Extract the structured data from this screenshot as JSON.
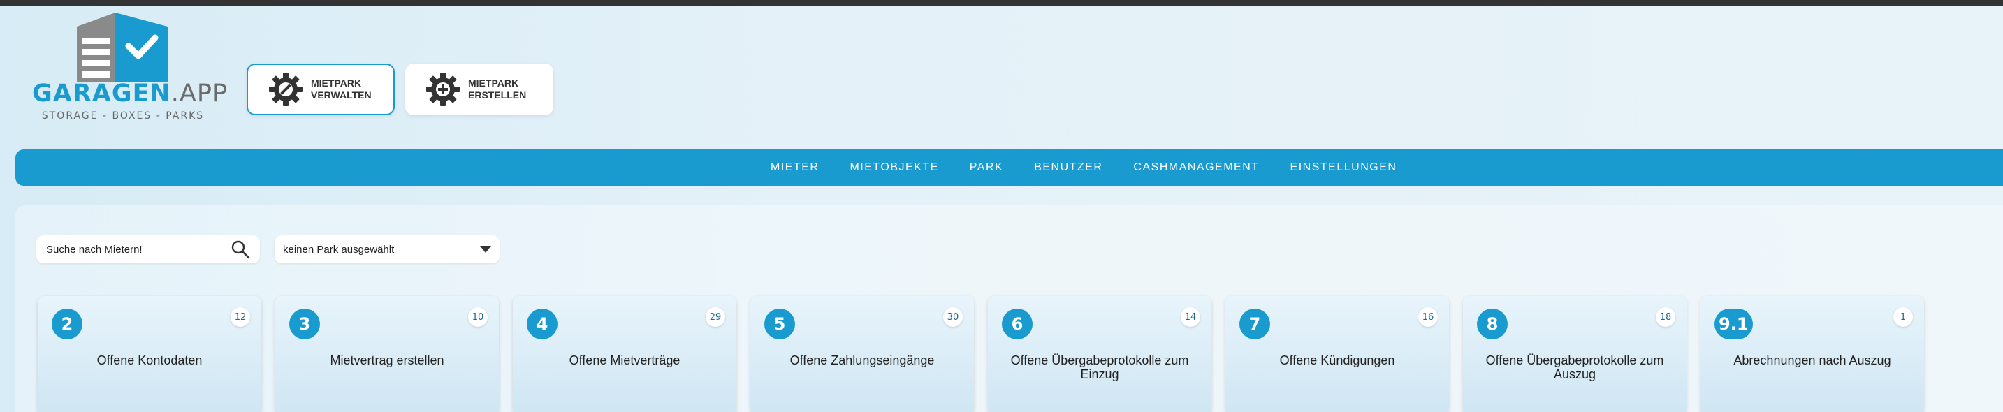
{
  "logo": {
    "word_primary": "GARAGEN",
    "word_secondary": ".APP",
    "tagline": "STORAGE - BOXES - PARKS"
  },
  "top_buttons": [
    {
      "label": "MIETPARK\nVERWALTEN",
      "icon": "gear-wrench-icon",
      "active": true
    },
    {
      "label": "MIETPARK\nERSTELLEN",
      "icon": "gear-plus-icon",
      "active": false
    }
  ],
  "nav": {
    "items": [
      "MIETER",
      "MIETOBJEKTE",
      "PARK",
      "BENUTZER",
      "CASHMANAGEMENT",
      "EINSTELLUNGEN"
    ]
  },
  "search": {
    "placeholder": "Suche nach Mietern!",
    "icon": "search-icon"
  },
  "park_select": {
    "selected": "keinen Park ausgewählt"
  },
  "cards": [
    {
      "number": "2",
      "badge": "12",
      "title": "Offene Kontodaten"
    },
    {
      "number": "3",
      "badge": "10",
      "title": "Mietvertrag erstellen"
    },
    {
      "number": "4",
      "badge": "29",
      "title": "Offene Mietverträge"
    },
    {
      "number": "5",
      "badge": "30",
      "title": "Offene Zahlungseingänge"
    },
    {
      "number": "6",
      "badge": "14",
      "title": "Offene Übergabeprotokolle zum Einzug"
    },
    {
      "number": "7",
      "badge": "16",
      "title": "Offene Kündigungen"
    },
    {
      "number": "8",
      "badge": "18",
      "title": "Offene Übergabeprotokolle zum Auszug"
    },
    {
      "number": "9.1",
      "badge": "1",
      "title": "Abrechnungen nach Auszug"
    }
  ],
  "colors": {
    "accent": "#1a9bd0",
    "background": "#e4f1f8"
  }
}
